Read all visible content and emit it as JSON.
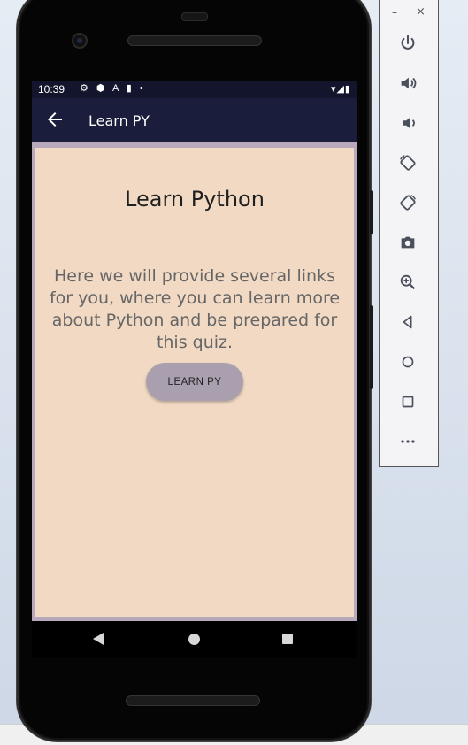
{
  "status_bar": {
    "time": "10:39",
    "left_icons": "⚙ ⬢ A ▮ •",
    "right_icons": "▾◢▮"
  },
  "app_bar": {
    "back_icon": "arrow-back-icon",
    "title": "Learn PY"
  },
  "main": {
    "title": "Learn Python",
    "description": "Here we will provide several links for you, where you can learn more about Python and be prepared for this quiz.",
    "button_label": "LEARN PY"
  },
  "nav_bar": {
    "icons": [
      "nav-back-icon",
      "nav-home-icon",
      "nav-recents-icon"
    ]
  },
  "emulator_panel": {
    "minimize": "–",
    "close": "×",
    "tools": [
      "power-icon",
      "volume-up-icon",
      "volume-down-icon",
      "rotate-left-icon",
      "rotate-right-icon",
      "camera-icon",
      "zoom-icon",
      "back-icon",
      "home-icon",
      "overview-icon",
      "more-icon"
    ]
  },
  "colors": {
    "status_bar": "#13152c",
    "app_bar": "#1a1d3b",
    "content_bg": "#f1d9c3",
    "screen_border": "#b7a9bb",
    "button_bg": "#a99fae"
  }
}
